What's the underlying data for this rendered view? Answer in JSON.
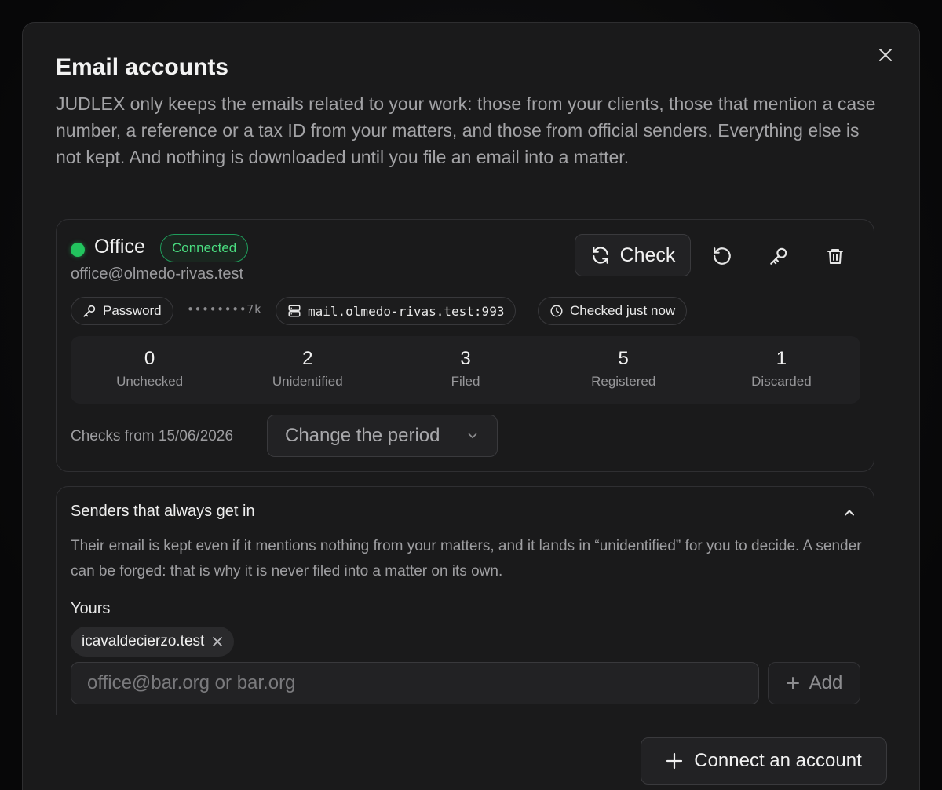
{
  "dialog": {
    "title": "Email accounts",
    "intro": "JUDLEX only keeps the emails related to your work: those from your clients, those that mention a case number, a reference or a tax ID from your matters, and those from official senders. Everything else is not kept. And nothing is downloaded until you file an email into a matter."
  },
  "account": {
    "name": "Office",
    "status": "Connected",
    "email": "office@olmedo-rivas.test",
    "check_label": "Check",
    "auth_chip": "Password",
    "masked_password": "••••••••7k",
    "server": "mail.olmedo-rivas.test:993",
    "last_check": "Checked just now",
    "stats": [
      {
        "value": "0",
        "label": "Unchecked"
      },
      {
        "value": "2",
        "label": "Unidentified"
      },
      {
        "value": "3",
        "label": "Filed"
      },
      {
        "value": "5",
        "label": "Registered"
      },
      {
        "value": "1",
        "label": "Discarded"
      }
    ],
    "period_label": "Checks from 15/06/2026",
    "period_select": "Change the period",
    "colors": {
      "status": "#22c55e",
      "badge": "#4ade80"
    }
  },
  "senders": {
    "title": "Senders that always get in",
    "description": "Their email is kept even if it mentions nothing from your matters, and it lands in “unidentified” for you to decide. A sender can be forged: that is why it is never filed into a matter on its own.",
    "yours_label": "Yours",
    "tags": [
      "icavaldecierzo.test"
    ],
    "input_value": "",
    "input_placeholder": "office@bar.org or bar.org",
    "add_label": "Add"
  },
  "footer": {
    "connect_label": "Connect an account"
  },
  "icons": [
    "close-icon",
    "refresh-icon",
    "undo-icon",
    "key-icon",
    "trash-icon",
    "server-icon",
    "clock-icon",
    "chevron-down-icon",
    "chevron-up-icon",
    "plus-icon"
  ]
}
